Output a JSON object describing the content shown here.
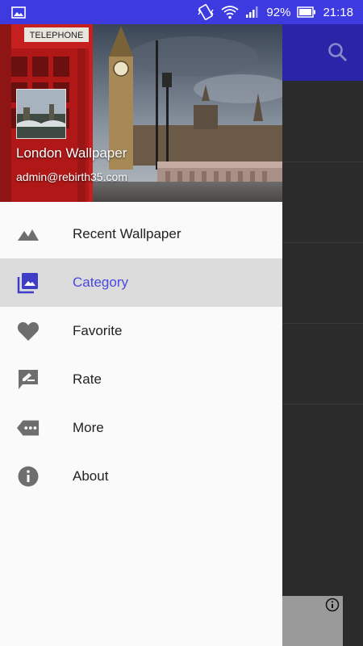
{
  "status_bar": {
    "battery_percent": "92%",
    "time": "21:18"
  },
  "drawer": {
    "header": {
      "app_name": "London Wallpaper",
      "email": "admin@rebirth35.com"
    },
    "menu": [
      {
        "label": "Recent Wallpaper",
        "icon": "landscape-icon",
        "active": false
      },
      {
        "label": "Category",
        "icon": "photo-library-icon",
        "active": true
      },
      {
        "label": "Favorite",
        "icon": "heart-icon",
        "active": false
      },
      {
        "label": "Rate",
        "icon": "rate-review-icon",
        "active": false
      },
      {
        "label": "More",
        "icon": "more-tag-icon",
        "active": false
      },
      {
        "label": "About",
        "icon": "info-icon",
        "active": false
      }
    ]
  },
  "colors": {
    "status_bar": "#3d3ae0",
    "toolbar": "#2a24a8",
    "accent": "#4a48e0"
  }
}
